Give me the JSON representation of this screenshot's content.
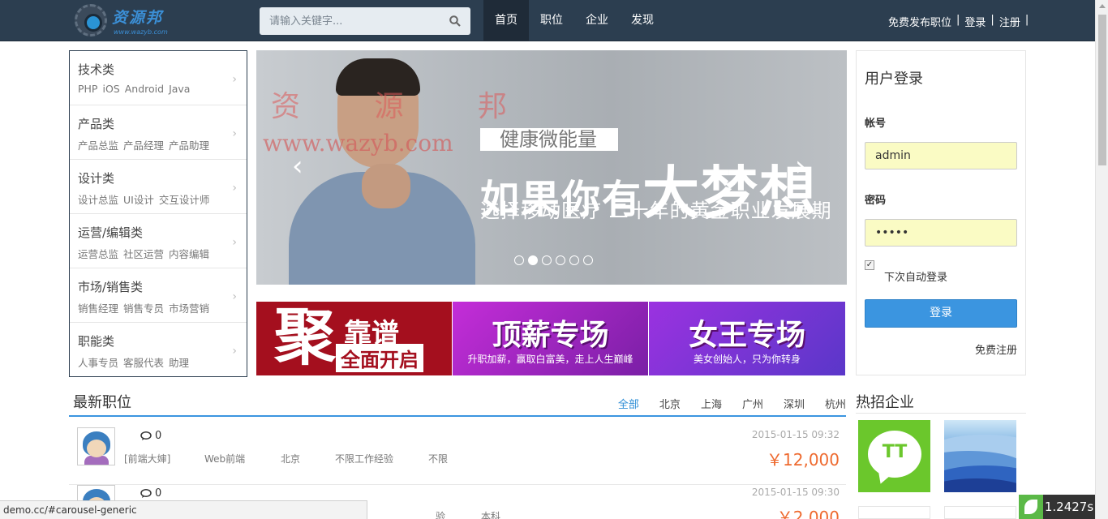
{
  "header": {
    "logo_text": "资源邦",
    "logo_sub": "www.wazyb.com",
    "search_placeholder": "请输入关键字...",
    "nav": [
      "首页",
      "职位",
      "企业",
      "发现"
    ],
    "active_nav": "首页",
    "links": [
      "免费发布职位",
      "登录",
      "注册"
    ]
  },
  "categories": [
    {
      "title": "技术类",
      "tags": [
        "PHP",
        "iOS",
        "Android",
        "Java"
      ]
    },
    {
      "title": "产品类",
      "tags": [
        "产品总监",
        "产品经理",
        "产品助理"
      ]
    },
    {
      "title": "设计类",
      "tags": [
        "设计总监",
        "UI设计",
        "交互设计师"
      ]
    },
    {
      "title": "运营/编辑类",
      "tags": [
        "运营总监",
        "社区运营",
        "内容编辑"
      ]
    },
    {
      "title": "市场/销售类",
      "tags": [
        "销售经理",
        "销售专员",
        "市场营销"
      ]
    },
    {
      "title": "职能类",
      "tags": [
        "人事专员",
        "客服代表",
        "助理"
      ]
    }
  ],
  "carousel": {
    "caption_small": "健康微能量",
    "caption_big_pre": "如果你有",
    "caption_big": "大梦想",
    "caption_line": "选择移动医疗 二十年的黄金职业发展期",
    "watermark_top": "资 源 邦",
    "watermark_url": "www.wazyb.com",
    "slides": 6,
    "active_slide": 2
  },
  "banners": [
    {
      "title_big": "聚",
      "title_right": "靠谱",
      "title_bottom": "全面开启"
    },
    {
      "title": "顶薪专场",
      "subtitle": "升职加薪，赢取白富美，走上人生巅峰"
    },
    {
      "title": "女王专场",
      "subtitle": "美女创始人，只为你转身"
    }
  ],
  "login": {
    "title": "用户登录",
    "username_label": "帐号",
    "username_value": "admin",
    "password_label": "密码",
    "password_value": "•••••",
    "remember_label": "下次自动登录",
    "remember_checked": true,
    "submit_label": "登录",
    "register_label": "免费注册"
  },
  "jobs": {
    "title": "最新职位",
    "cities": [
      "全部",
      "北京",
      "上海",
      "广州",
      "深圳",
      "杭州"
    ],
    "active_city": "全部",
    "items": [
      {
        "comments": "0",
        "author": "[前端大婶]",
        "position": "Web前端",
        "city": "北京",
        "experience": "不限工作经验",
        "education": "不限",
        "time": "2015-01-15 09:32",
        "salary": "￥12,000"
      },
      {
        "comments": "0",
        "author": "",
        "position": "",
        "city": "",
        "experience": "验",
        "education": "本科",
        "time": "2015-01-15 09:30",
        "salary": "￥2,000"
      }
    ]
  },
  "hot_companies": {
    "title": "热招企业",
    "logos": [
      "TT"
    ]
  },
  "statusbar": {
    "url": "demo.cc/#carousel-generic"
  },
  "timer": {
    "value": "1.2427s"
  },
  "colors": {
    "header_bg": "#2c3e50",
    "accent": "#3b95e0",
    "salary": "#ee6a2f",
    "banner_red": "#a40f1e"
  }
}
